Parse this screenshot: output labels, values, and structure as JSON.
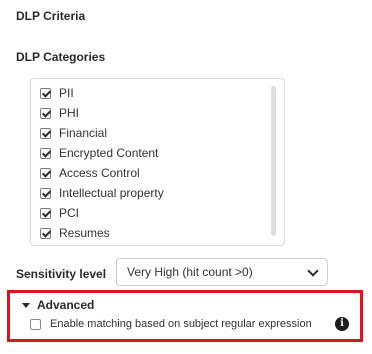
{
  "criteria": {
    "title": "DLP Criteria"
  },
  "categories": {
    "title": "DLP Categories",
    "items": [
      {
        "label": "PII",
        "checked": true
      },
      {
        "label": "PHI",
        "checked": true
      },
      {
        "label": "Financial",
        "checked": true
      },
      {
        "label": "Encrypted Content",
        "checked": true
      },
      {
        "label": "Access Control",
        "checked": true
      },
      {
        "label": "Intellectual property",
        "checked": true
      },
      {
        "label": "PCI",
        "checked": true
      },
      {
        "label": "Resumes",
        "checked": true
      }
    ]
  },
  "sensitivity": {
    "label": "Sensitivity level",
    "selected": "Very High (hit count >0)"
  },
  "advanced": {
    "title": "Advanced",
    "option_label": "Enable matching based on subject regular expression",
    "option_checked": false,
    "info_glyph": "i",
    "info_icon": "info-circle-icon"
  },
  "colors": {
    "highlight": "#d7191f",
    "info_icon_bg": "#1e1e1e"
  }
}
